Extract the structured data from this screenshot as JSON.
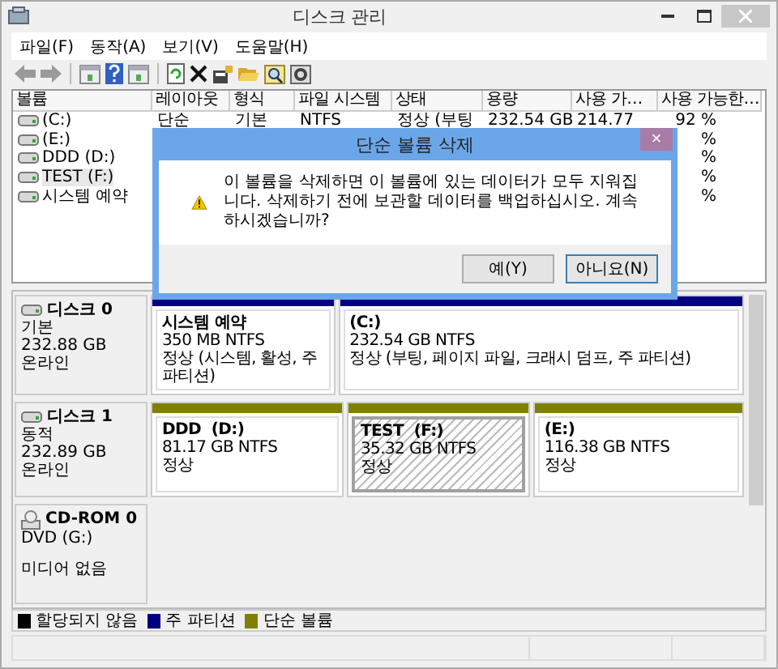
{
  "window": {
    "title": "디스크 관리"
  },
  "menu": [
    "파일(F)",
    "동작(A)",
    "보기(V)",
    "도움말(H)"
  ],
  "volumes": {
    "columns": [
      "볼륨",
      "레이아웃",
      "형식",
      "파일 시스템",
      "상태",
      "용량",
      "사용 가…",
      "사용 가능한…"
    ],
    "rows": [
      {
        "volume": "(C:)",
        "layout": "단순",
        "type": "기본",
        "file_system": "NTFS",
        "status": "정상 (부팅",
        "capacity": "232.54 GB",
        "free": "214.77",
        "free_pct": "92 %",
        "selected": false
      },
      {
        "volume": "(E:)",
        "free_pct": "%",
        "selected": false
      },
      {
        "volume": "DDD (D:)",
        "free_pct": "%",
        "selected": false
      },
      {
        "volume": "TEST (F:)",
        "free_pct": "%",
        "selected": true
      },
      {
        "volume": "시스템 예약",
        "free_pct": "%",
        "selected": false
      }
    ]
  },
  "disks": [
    {
      "kind": "disk",
      "name": "디스크 0",
      "type": "기본",
      "size": "232.88 GB",
      "status": "온라인",
      "partitions": [
        {
          "name": "시스템 예약",
          "size": "350 MB NTFS",
          "status": "정상 (시스템, 활성, 주 파티션)",
          "color": "#000080",
          "selected": false
        },
        {
          "name": "(C:)",
          "size": "232.54 GB NTFS",
          "status": "정상 (부팅, 페이지 파일, 크래시 덤프, 주 파티션)",
          "color": "#000080",
          "selected": false
        }
      ]
    },
    {
      "kind": "disk",
      "name": "디스크 1",
      "type": "동적",
      "size": "232.89 GB",
      "status": "온라인",
      "partitions": [
        {
          "name": "DDD  (D:)",
          "size": "81.17 GB NTFS",
          "status": "정상",
          "color": "#808000",
          "selected": false
        },
        {
          "name": "TEST  (F:)",
          "size": "35.32 GB NTFS",
          "status": "정상",
          "color": "#808000",
          "selected": true
        },
        {
          "name": "(E:)",
          "size": "116.38 GB NTFS",
          "status": "정상",
          "color": "#808000",
          "selected": false
        }
      ]
    },
    {
      "kind": "cdrom",
      "name": "CD-ROM 0",
      "type": "DVD (G:)",
      "status": "미디어 없음"
    }
  ],
  "legend": [
    {
      "label": "할당되지 않음",
      "color": "#000000"
    },
    {
      "label": "주 파티션",
      "color": "#000080"
    },
    {
      "label": "단순 볼륨",
      "color": "#808000"
    }
  ],
  "dialog": {
    "title": "단순 볼륨 삭제",
    "close": "×",
    "message": "이 볼륨을 삭제하면 이 볼륨에 있는 데이터가 모두 지워집니다. 삭제하기 전에 보관할 데이터를 백업하십시오. 계속하시겠습니까?",
    "buttons": [
      {
        "label": "예(Y)",
        "default": false
      },
      {
        "label": "아니요(N)",
        "default": true
      }
    ]
  }
}
